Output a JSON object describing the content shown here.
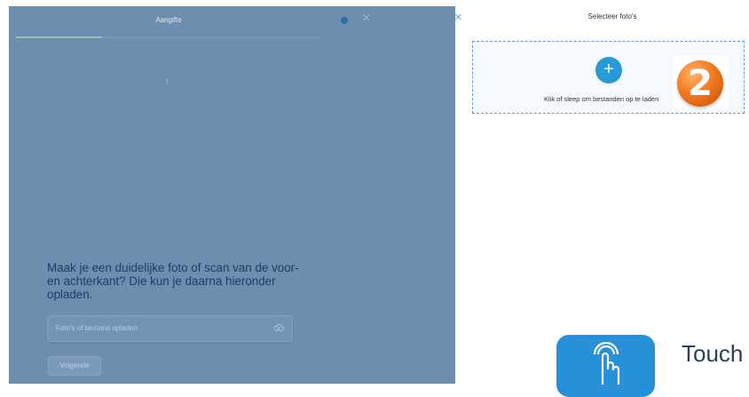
{
  "form_screen": {
    "title": "Aangifte",
    "close_icon": "×",
    "upload_arrow_icon": "↑",
    "instruction": "Maak je een duidelijke foto of scan van de voor- en achterkant? Die kun je daarna hieronder opladen.",
    "upload_field_label": "Foto's of bestand opladen",
    "upload_field_icon": "cloud-upload-icon",
    "next_button": "Volgende"
  },
  "file_picker": {
    "close_icon": "×",
    "title": "Selecteer foto's",
    "add_button_icon": "+",
    "dropzone_hint": "Klik of sleep om bestanden op te laden"
  },
  "step_badge": {
    "number": "2"
  },
  "touch_sticker": {
    "label": "Touch",
    "icon": "hand-tap-icon"
  },
  "colors": {
    "overlay_blue": "#6e8eb0",
    "accent_blue": "#2a9ad6",
    "badge_orange": "#f37a1f",
    "touch_tile_blue": "#2690d8"
  }
}
